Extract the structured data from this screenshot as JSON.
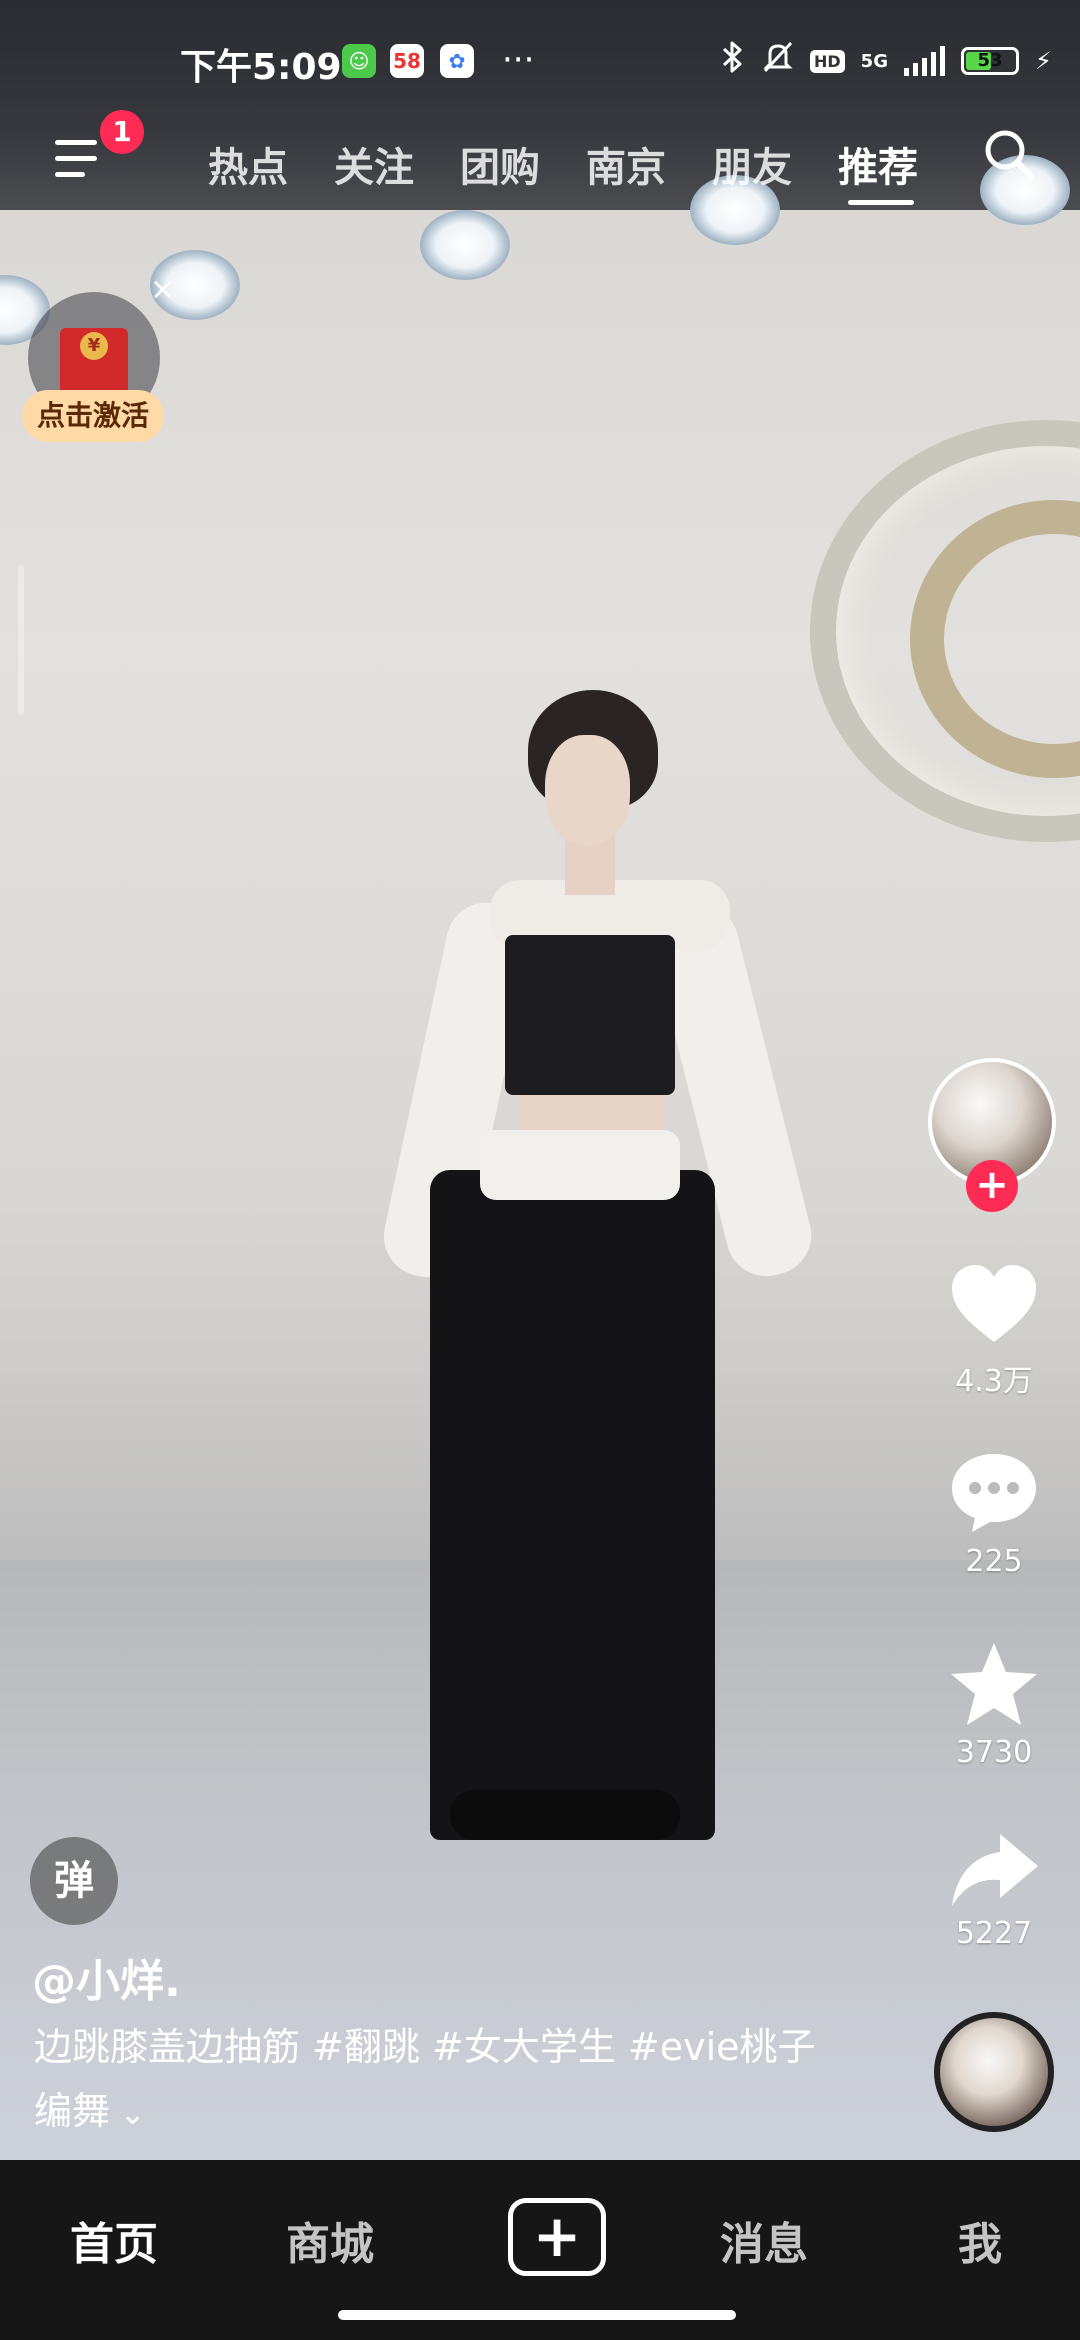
{
  "status_bar": {
    "time": "下午5:09",
    "app_icons": [
      "cat-app-icon",
      "58-app-icon",
      "baidu-app-icon"
    ],
    "more": "···",
    "hd_label": "HD",
    "network": "5G",
    "battery": "53",
    "battery_level": 0.53
  },
  "top_nav": {
    "menu_badge": "1",
    "tabs": [
      {
        "label": "热点"
      },
      {
        "label": "关注"
      },
      {
        "label": "团购"
      },
      {
        "label": "南京"
      },
      {
        "label": "朋友"
      },
      {
        "label": "推荐"
      }
    ],
    "active_tab": "推荐"
  },
  "promo": {
    "activate_label": "点击激活",
    "close": "×",
    "coin": "¥"
  },
  "actions": {
    "follow_plus": "+",
    "likes": "4.3万",
    "comments": "225",
    "favorites": "3730",
    "shares": "5227"
  },
  "post": {
    "danmu_label": "弹",
    "username": "@小烊.",
    "caption": "边跳膝盖边抽筋 #翻跳 #女大学生 #evie桃子编舞",
    "expand_icon": "⌄"
  },
  "bottom_nav": {
    "items": [
      "首页",
      "商城",
      "消息",
      "我"
    ],
    "plus": "+",
    "active": "首页"
  },
  "colors": {
    "accent": "#fe2c55",
    "promo_bg": "#ffd9a6",
    "battery_fill": "#58d64a",
    "nav_bg": "#161616"
  }
}
